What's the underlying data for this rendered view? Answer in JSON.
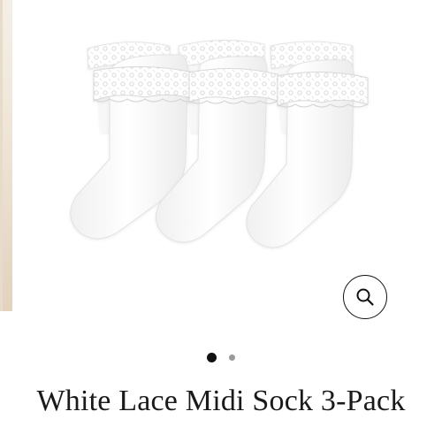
{
  "product": {
    "title": "White Lace Midi Sock 3-Pack",
    "image_alt": "white-lace-midi-sock-3-pack-image"
  },
  "gallery": {
    "zoom_icon": "search-icon",
    "active_slide": 1,
    "slide_count": 2
  },
  "colors": {
    "title": "#1a1a1a",
    "dot_active": "#111111",
    "dot_inactive": "#9a9a9a",
    "sock": "#ffffff",
    "sock_shadow": "#e6e6e6"
  }
}
